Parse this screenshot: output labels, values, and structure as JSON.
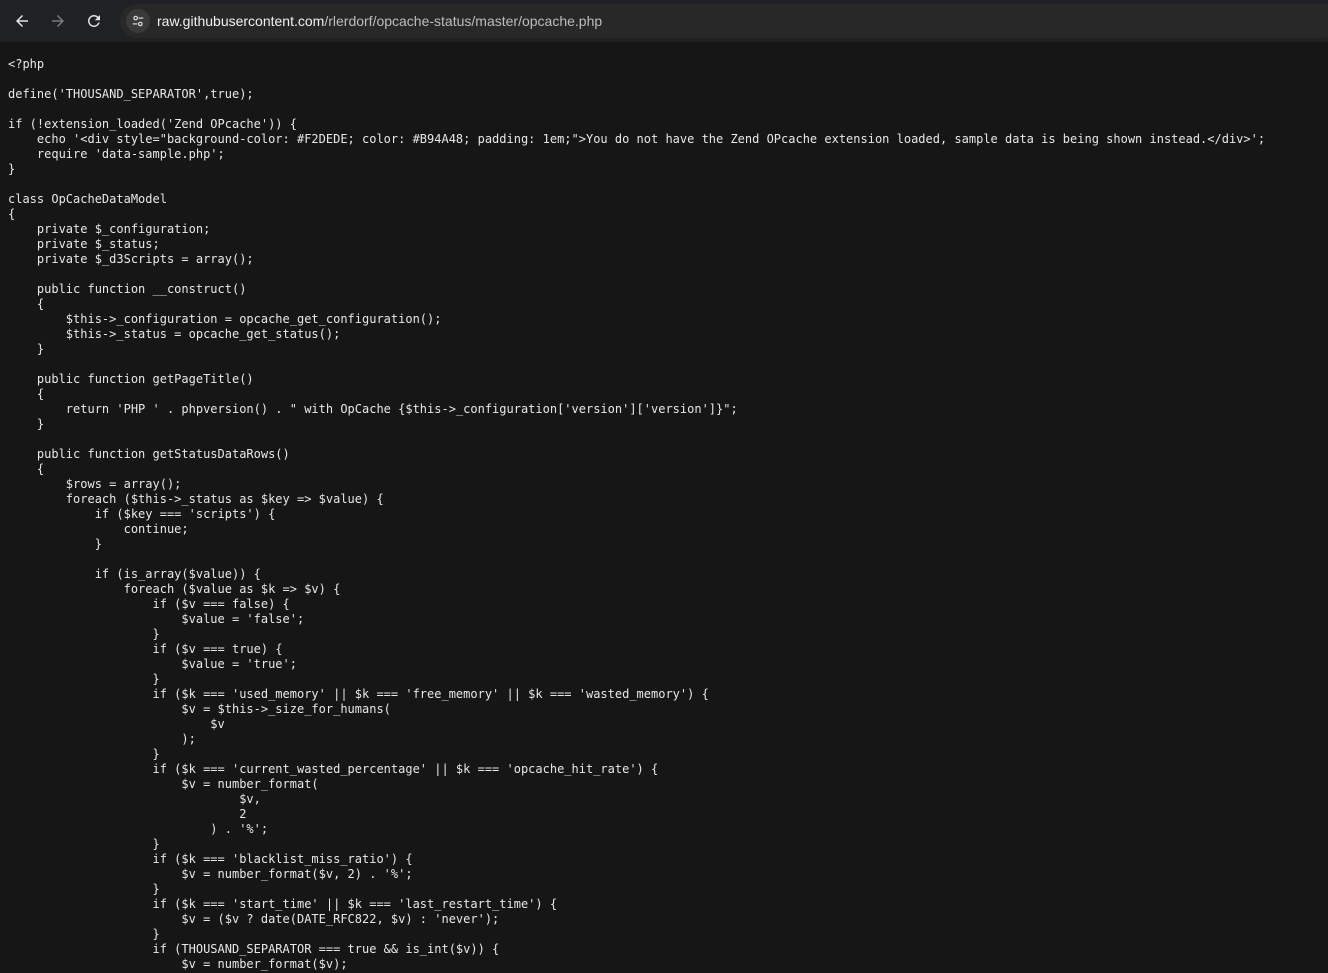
{
  "browser": {
    "address_bar": {
      "host": "raw.githubusercontent.com",
      "path": "/rlerdorf/opcache-status/master/opcache.php"
    },
    "icons": {
      "back": "arrow-left-icon",
      "forward": "arrow-right-icon",
      "reload": "reload-icon",
      "site_info": "tune-icon"
    }
  },
  "code_lines": [
    "<?php",
    "",
    "define('THOUSAND_SEPARATOR',true);",
    "",
    "if (!extension_loaded('Zend OPcache')) {",
    "    echo '<div style=\"background-color: #F2DEDE; color: #B94A48; padding: 1em;\">You do not have the Zend OPcache extension loaded, sample data is being shown instead.</div>';",
    "    require 'data-sample.php';",
    "}",
    "",
    "class OpCacheDataModel",
    "{",
    "    private $_configuration;",
    "    private $_status;",
    "    private $_d3Scripts = array();",
    "",
    "    public function __construct()",
    "    {",
    "        $this->_configuration = opcache_get_configuration();",
    "        $this->_status = opcache_get_status();",
    "    }",
    "",
    "    public function getPageTitle()",
    "    {",
    "        return 'PHP ' . phpversion() . \" with OpCache {$this->_configuration['version']['version']}\";",
    "    }",
    "",
    "    public function getStatusDataRows()",
    "    {",
    "        $rows = array();",
    "        foreach ($this->_status as $key => $value) {",
    "            if ($key === 'scripts') {",
    "                continue;",
    "            }",
    "",
    "            if (is_array($value)) {",
    "                foreach ($value as $k => $v) {",
    "                    if ($v === false) {",
    "                        $value = 'false';",
    "                    }",
    "                    if ($v === true) {",
    "                        $value = 'true';",
    "                    }",
    "                    if ($k === 'used_memory' || $k === 'free_memory' || $k === 'wasted_memory') {",
    "                        $v = $this->_size_for_humans(",
    "                            $v",
    "                        );",
    "                    }",
    "                    if ($k === 'current_wasted_percentage' || $k === 'opcache_hit_rate') {",
    "                        $v = number_format(",
    "                                $v,",
    "                                2",
    "                            ) . '%';",
    "                    }",
    "                    if ($k === 'blacklist_miss_ratio') {",
    "                        $v = number_format($v, 2) . '%';",
    "                    }",
    "                    if ($k === 'start_time' || $k === 'last_restart_time') {",
    "                        $v = ($v ? date(DATE_RFC822, $v) : 'never');",
    "                    }",
    "                    if (THOUSAND_SEPARATOR === true && is_int($v)) {",
    "                        $v = number_format($v);"
  ]
}
